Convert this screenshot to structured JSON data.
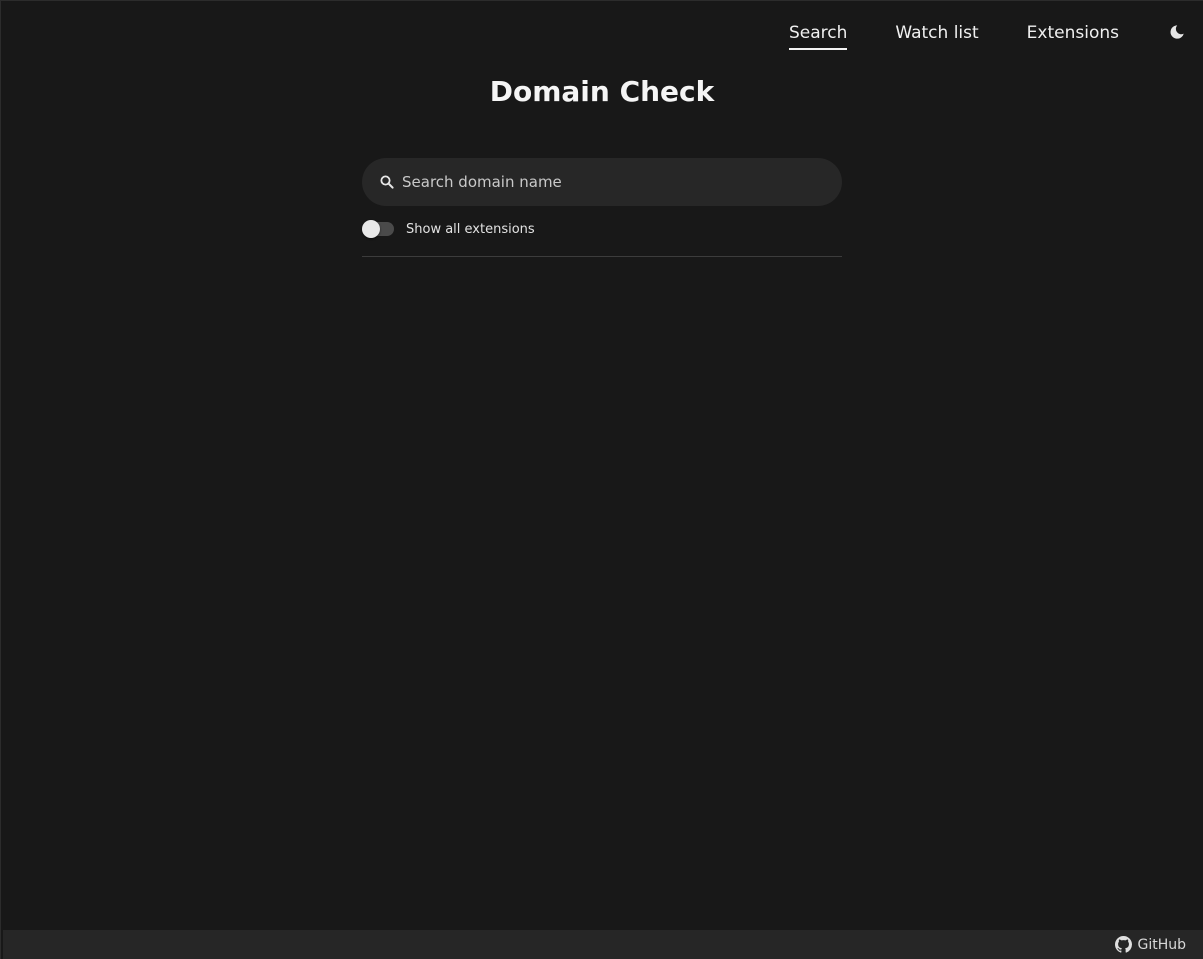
{
  "nav": {
    "items": [
      {
        "label": "Search",
        "active": true
      },
      {
        "label": "Watch list",
        "active": false
      },
      {
        "label": "Extensions",
        "active": false
      }
    ],
    "theme_icon": "moon-icon"
  },
  "title": "Domain Check",
  "search": {
    "placeholder": "Search domain name",
    "value": "",
    "icon": "search-icon"
  },
  "toggle": {
    "label": "Show all extensions",
    "checked": false
  },
  "footer": {
    "github_label": "GitHub",
    "github_icon": "github-icon"
  },
  "colors": {
    "background": "#181818",
    "surface": "#272727",
    "footer": "#262626",
    "text": "#f0f0f0"
  }
}
